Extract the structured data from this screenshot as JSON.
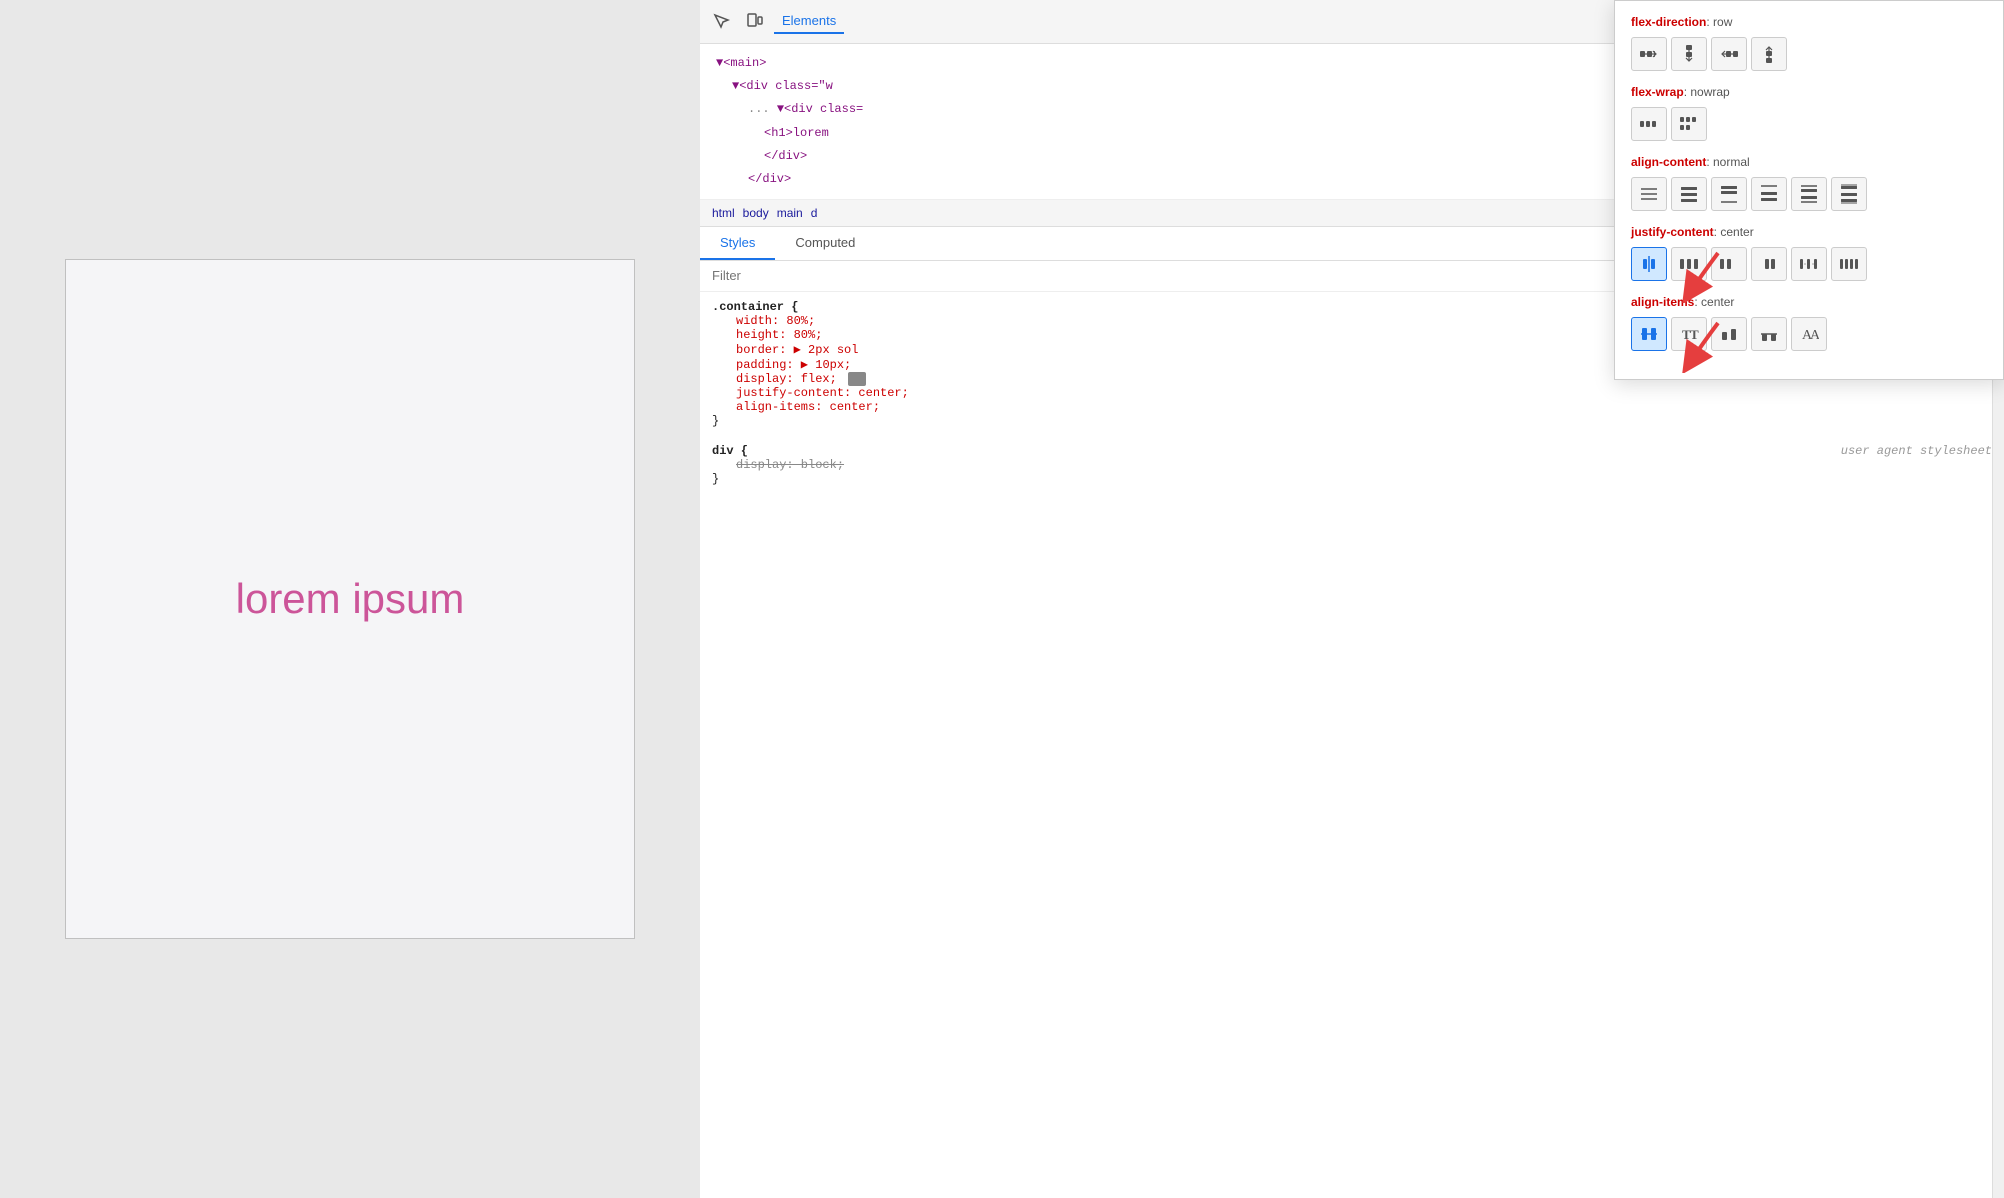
{
  "preview": {
    "lorem_text": "lorem ipsum"
  },
  "devtools": {
    "tabs": [
      {
        "label": "Elements",
        "active": true
      }
    ],
    "elements": {
      "lines": [
        {
          "text": "▼<main>",
          "indent": 0
        },
        {
          "text": "▼<div class=\"w",
          "indent": 1
        },
        {
          "text": "▼<div class=",
          "indent": 2
        },
        {
          "text": "<h1>lorem",
          "indent": 3
        },
        {
          "text": "</div>",
          "indent": 3
        },
        {
          "text": "</div>",
          "indent": 2
        }
      ]
    },
    "breadcrumb": {
      "items": [
        "html",
        "body",
        "main",
        "d"
      ]
    },
    "styles_tabs": [
      {
        "label": "Styles",
        "active": true
      },
      {
        "label": "Computed",
        "active": false
      }
    ],
    "filter": {
      "placeholder": "Filter"
    },
    "css_rules": [
      {
        "selector": ".container {",
        "properties": [
          {
            "name": "width",
            "value": "80%;"
          },
          {
            "name": "height",
            "value": "80%;"
          },
          {
            "name": "border",
            "value": "▶ 2px sol"
          },
          {
            "name": "padding",
            "value": "▶ 10px;"
          },
          {
            "name": "display",
            "value": "flex;",
            "has_icon": true
          },
          {
            "name": "justify-content",
            "value": "center;"
          },
          {
            "name": "align-items",
            "value": "center;"
          }
        ],
        "close": "}"
      },
      {
        "selector": "div {",
        "comment": "user agent stylesheet",
        "properties": [
          {
            "name": "display",
            "value": "block;",
            "strikethrough": true
          }
        ],
        "close": "}"
      }
    ],
    "flex_inspector": {
      "properties": [
        {
          "name": "flex-direction",
          "value": "row",
          "icons": [
            {
              "id": "row-lr",
              "active": false,
              "symbol": "→→"
            },
            {
              "id": "row-tb",
              "active": false,
              "symbol": "↓↓"
            },
            {
              "id": "row-rl",
              "active": false,
              "symbol": "←←"
            },
            {
              "id": "row-bt",
              "active": false,
              "symbol": "↑↑"
            }
          ]
        },
        {
          "name": "flex-wrap",
          "value": "nowrap",
          "icons": [
            {
              "id": "nowrap",
              "active": false,
              "symbol": "≡≡"
            },
            {
              "id": "wrap",
              "active": false,
              "symbol": "⊞⊞"
            }
          ]
        },
        {
          "name": "align-content",
          "value": "normal",
          "icons": [
            {
              "id": "ac1",
              "active": false
            },
            {
              "id": "ac2",
              "active": false
            },
            {
              "id": "ac3",
              "active": false
            },
            {
              "id": "ac4",
              "active": false
            },
            {
              "id": "ac5",
              "active": false
            },
            {
              "id": "ac6",
              "active": false
            }
          ]
        },
        {
          "name": "justify-content",
          "value": "center",
          "icons": [
            {
              "id": "jc1",
              "active": true
            },
            {
              "id": "jc2",
              "active": false
            },
            {
              "id": "jc3",
              "active": false
            },
            {
              "id": "jc4",
              "active": false
            },
            {
              "id": "jc5",
              "active": false
            },
            {
              "id": "jc6",
              "active": false
            }
          ]
        },
        {
          "name": "align-items",
          "value": "center",
          "icons": [
            {
              "id": "ai1",
              "active": true
            },
            {
              "id": "ai2",
              "active": false
            },
            {
              "id": "ai3",
              "active": false
            },
            {
              "id": "ai4",
              "active": false
            },
            {
              "id": "ai5",
              "active": false
            }
          ]
        }
      ]
    }
  }
}
